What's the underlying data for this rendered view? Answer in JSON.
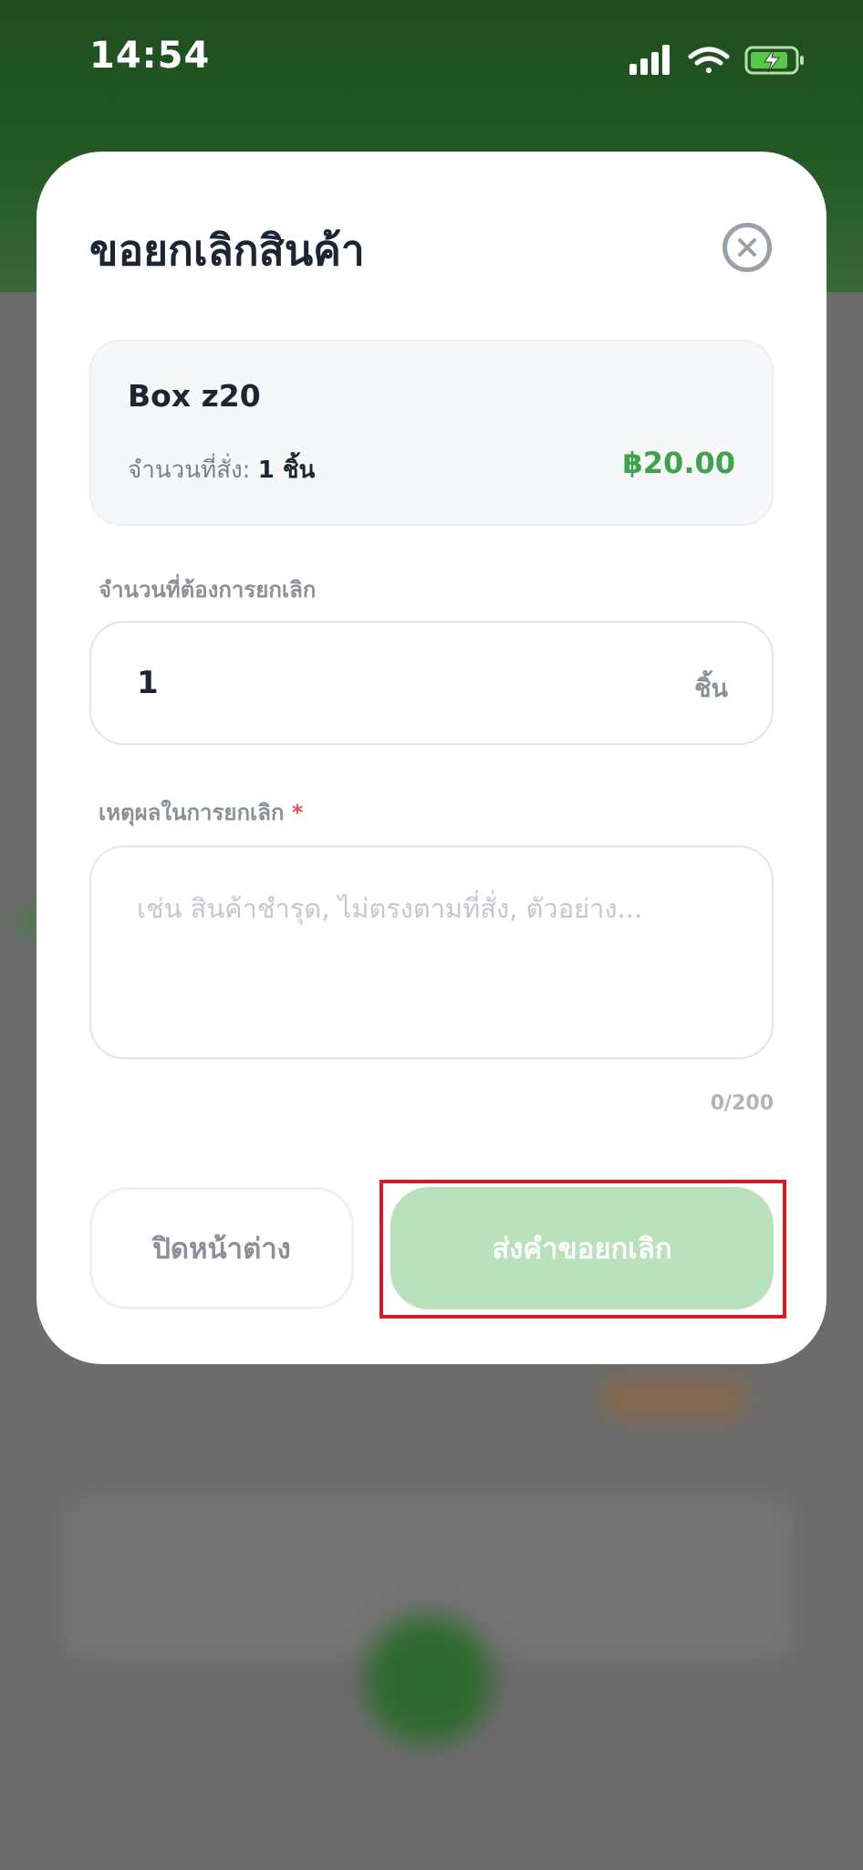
{
  "status_bar": {
    "time": "14:54",
    "icons": [
      "cellular-signal-icon",
      "wifi-icon",
      "battery-charging-icon"
    ]
  },
  "modal": {
    "title": "ขอยกเลิกสินค้า",
    "close_icon": "close-circle-icon",
    "product": {
      "name": "Box z20",
      "quantity_label": "จำนวนที่สั่ง:",
      "quantity_value": "1 ชิ้น",
      "price": "฿20.00"
    },
    "cancel_quantity": {
      "label": "จำนวนที่ต้องการยกเลิก",
      "value": "1",
      "unit": "ชิ้น"
    },
    "reason": {
      "label": "เหตุผลในการยกเลิก",
      "required_mark": "*",
      "placeholder": "เช่น สินค้าชำรุด, ไม่ตรงตามที่สั่ง, ตัวอย่าง...",
      "char_count": "0/200"
    },
    "buttons": {
      "close_label": "ปิดหน้าต่าง",
      "submit_label": "ส่งคำขอยกเลิก"
    }
  },
  "colors": {
    "accent_green": "#3fa34d",
    "submit_disabled": "#b9e1bb",
    "highlight_red": "#d01f2a"
  }
}
